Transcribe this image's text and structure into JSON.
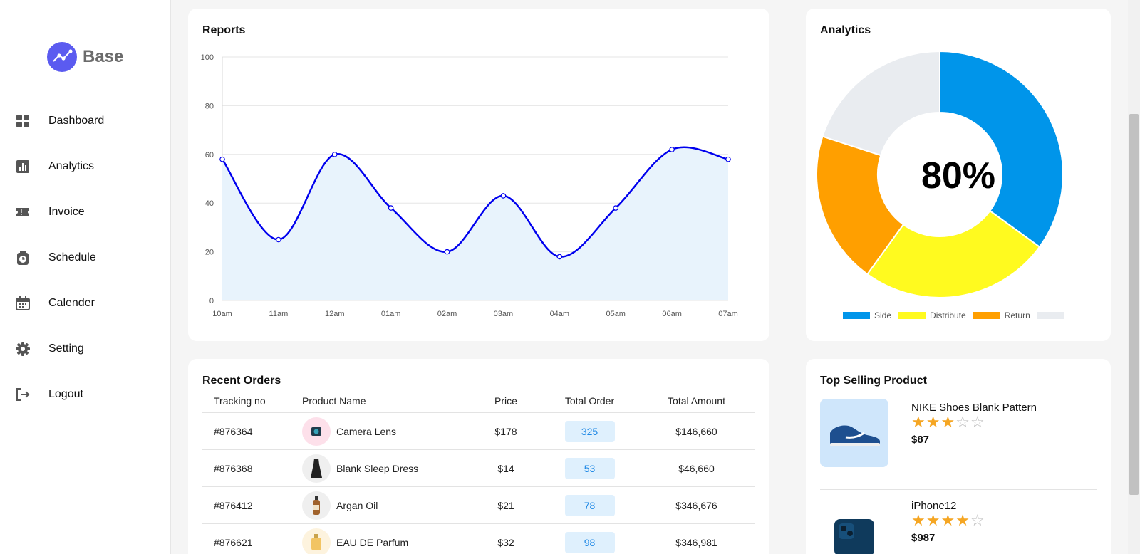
{
  "brand": {
    "name": "Base"
  },
  "nav": [
    {
      "label": "Dashboard",
      "icon": "dashboard-icon"
    },
    {
      "label": "Analytics",
      "icon": "analytics-icon"
    },
    {
      "label": "Invoice",
      "icon": "invoice-icon"
    },
    {
      "label": "Schedule",
      "icon": "schedule-icon"
    },
    {
      "label": "Calender",
      "icon": "calendar-icon"
    },
    {
      "label": "Setting",
      "icon": "gear-icon"
    },
    {
      "label": "Logout",
      "icon": "logout-icon"
    }
  ],
  "reports": {
    "title": "Reports"
  },
  "analytics": {
    "title": "Analytics",
    "center_value": "80%"
  },
  "orders": {
    "title": "Recent Orders",
    "headers": {
      "tracking": "Tracking no",
      "name": "Product Name",
      "price": "Price",
      "total": "Total Order",
      "amount": "Total Amount"
    },
    "rows": [
      {
        "tracking": "#876364",
        "name": "Camera Lens",
        "price": "$178",
        "total": "325",
        "amount": "$146,660"
      },
      {
        "tracking": "#876368",
        "name": "Blank Sleep Dress",
        "price": "$14",
        "total": "53",
        "amount": "$46,660"
      },
      {
        "tracking": "#876412",
        "name": "Argan Oil",
        "price": "$21",
        "total": "78",
        "amount": "$346,676"
      },
      {
        "tracking": "#876621",
        "name": "EAU DE Parfum",
        "price": "$32",
        "total": "98",
        "amount": "$346,981"
      }
    ]
  },
  "top_selling": {
    "title": "Top Selling Product",
    "products": [
      {
        "name": "NIKE Shoes Blank Pattern",
        "rating": 3,
        "max_rating": 5,
        "price": "$87"
      },
      {
        "name": "iPhone12",
        "rating": 4,
        "max_rating": 5,
        "price": "$987"
      }
    ]
  },
  "colors": {
    "line": "#0000ee",
    "area": "#e8f3fc",
    "side": "#0095ea",
    "distribute": "#fffa1f",
    "return": "#ff9f00",
    "rest": "#e9ecf0",
    "brand": "#5b5bf0",
    "star": "#f5a623"
  },
  "chart_data": [
    {
      "type": "area",
      "title": "Reports",
      "categories": [
        "10am",
        "11am",
        "12am",
        "01am",
        "02am",
        "03am",
        "04am",
        "05am",
        "06am",
        "07am"
      ],
      "values": [
        58,
        25,
        60,
        38,
        20,
        43,
        18,
        38,
        62,
        58
      ],
      "ylim": [
        0,
        100
      ],
      "yticks": [
        0,
        20,
        40,
        60,
        80,
        100
      ],
      "grid": true
    },
    {
      "type": "pie",
      "title": "Analytics",
      "labels": [
        "Side",
        "Distribute",
        "Return",
        ""
      ],
      "values": [
        35,
        25,
        20,
        20
      ],
      "legend": "bottom"
    }
  ]
}
